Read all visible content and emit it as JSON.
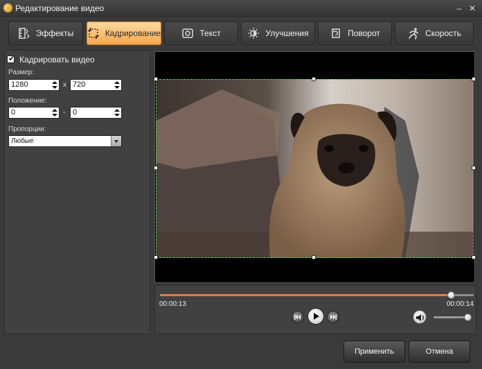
{
  "window": {
    "title": "Редактирование видео",
    "minimize_label": "–",
    "close_label": "✕"
  },
  "tabs": [
    {
      "label": "Эффекты",
      "icon": "effects-icon"
    },
    {
      "label": "Кадрирование",
      "icon": "crop-icon"
    },
    {
      "label": "Текст",
      "icon": "text-icon"
    },
    {
      "label": "Улучшения",
      "icon": "enhance-icon"
    },
    {
      "label": "Поворот",
      "icon": "rotate-icon"
    },
    {
      "label": "Скорость",
      "icon": "speed-icon"
    }
  ],
  "crop_panel": {
    "crop_video_label": "Кадрировать видео",
    "crop_video_checked": true,
    "size_label": "Размер:",
    "width": "1280",
    "size_sep": "x",
    "height": "720",
    "position_label": "Положение:",
    "pos_x": "0",
    "pos_sep": "-",
    "pos_y": "0",
    "proportions_label": "Пропорции:",
    "proportions_value": "Любые"
  },
  "player": {
    "time_current": "00:00:13",
    "time_total": "00:00:14",
    "progress": 0.93,
    "volume": 0.92
  },
  "buttons": {
    "apply": "Применить",
    "cancel": "Отмена"
  },
  "colors": {
    "accent": "#f6a64b",
    "progress": "#f07a3a",
    "crop_border": "#4fd04f"
  }
}
